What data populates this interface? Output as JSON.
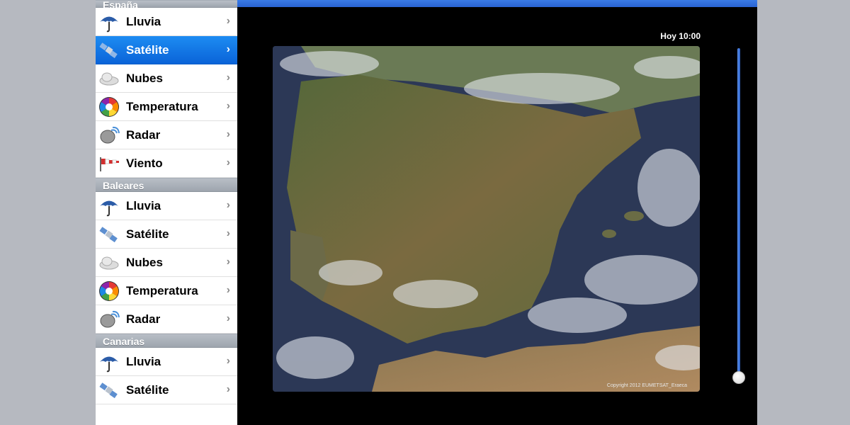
{
  "sidebar": {
    "sections": [
      {
        "title": "España",
        "items": [
          {
            "label": "Lluvia",
            "icon": "umbrella-icon"
          },
          {
            "label": "Satélite",
            "icon": "satellite-icon",
            "selected": true
          },
          {
            "label": "Nubes",
            "icon": "cloud-icon"
          },
          {
            "label": "Temperatura",
            "icon": "color-wheel-icon"
          },
          {
            "label": "Radar",
            "icon": "radar-dish-icon"
          },
          {
            "label": "Viento",
            "icon": "windsock-icon"
          }
        ]
      },
      {
        "title": "Baleares",
        "items": [
          {
            "label": "Lluvia",
            "icon": "umbrella-icon"
          },
          {
            "label": "Satélite",
            "icon": "satellite-icon"
          },
          {
            "label": "Nubes",
            "icon": "cloud-icon"
          },
          {
            "label": "Temperatura",
            "icon": "color-wheel-icon"
          },
          {
            "label": "Radar",
            "icon": "radar-dish-icon"
          }
        ]
      },
      {
        "title": "Canarias",
        "items": [
          {
            "label": "Lluvia",
            "icon": "umbrella-icon"
          },
          {
            "label": "Satélite",
            "icon": "satellite-icon"
          }
        ]
      }
    ],
    "chevron": "›"
  },
  "main": {
    "time_label": "Hoy 10:00",
    "copyright": "Copyright 2012 EUMETSAT_Eraeca",
    "slider_level": 1.0
  },
  "colors": {
    "selected_row": "#1d8cf2",
    "top_bar": "#3a7be6",
    "slider": "#2d63cc"
  }
}
